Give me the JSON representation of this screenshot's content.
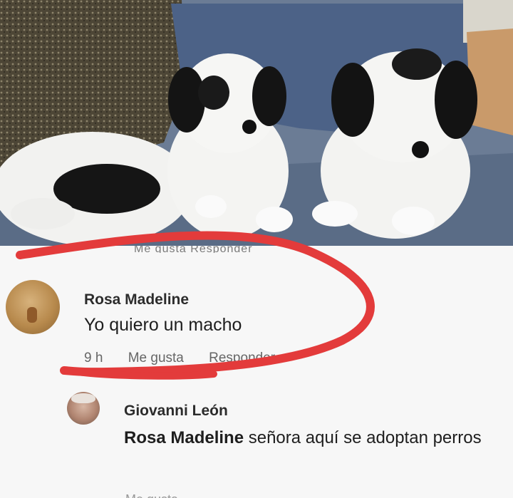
{
  "photo": {
    "subject": "three black and white puppies on a blue couch"
  },
  "post": {
    "cut_line_text": "Me gusta  Responder"
  },
  "comment": {
    "author": "Rosa Madeline",
    "text": "Yo quiero un macho",
    "time": "9 h",
    "like_label": "Me gusta",
    "reply_label": "Responder"
  },
  "reply": {
    "author": "Giovanni León",
    "mention": "Rosa Madeline",
    "text": " señora aquí se adoptan perros"
  },
  "colors": {
    "annotation_red": "#e33b3b",
    "couch_blue": "#5f6f86"
  }
}
